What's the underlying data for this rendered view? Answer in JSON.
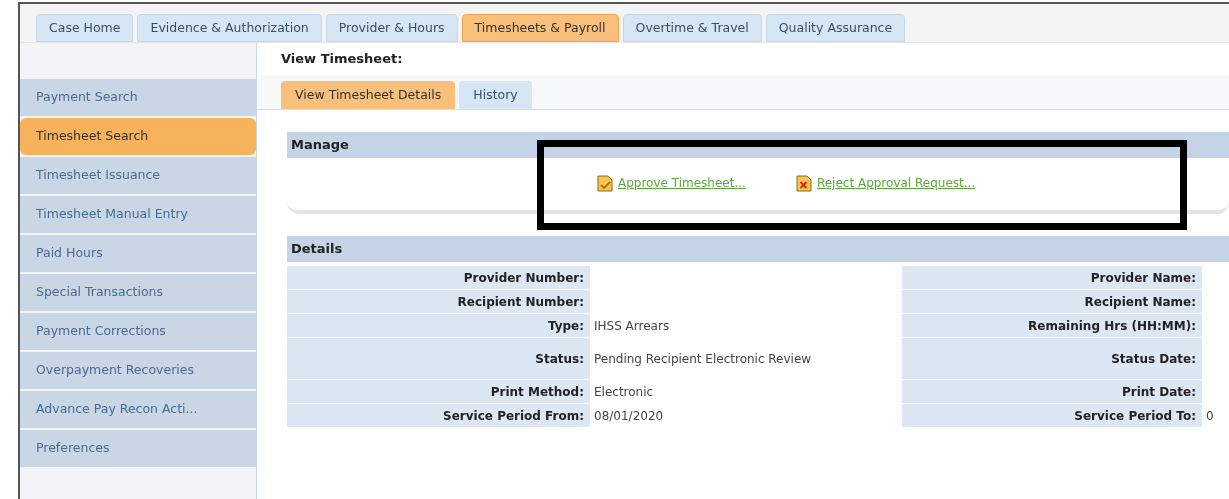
{
  "top_tabs": [
    {
      "label": "Case Home",
      "selected": false
    },
    {
      "label": "Evidence & Authorization",
      "selected": false
    },
    {
      "label": "Provider & Hours",
      "selected": false
    },
    {
      "label": "Timesheets & Payroll",
      "selected": true
    },
    {
      "label": "Overtime & Travel",
      "selected": false
    },
    {
      "label": "Quality Assurance",
      "selected": false
    }
  ],
  "sidebar": {
    "items": [
      {
        "label": "Payment Search",
        "selected": false
      },
      {
        "label": "Timesheet Search",
        "selected": true
      },
      {
        "label": "Timesheet Issuance",
        "selected": false
      },
      {
        "label": "Timesheet Manual Entry",
        "selected": false
      },
      {
        "label": "Paid Hours",
        "selected": false
      },
      {
        "label": "Special Transactions",
        "selected": false
      },
      {
        "label": "Payment Corrections",
        "selected": false
      },
      {
        "label": "Overpayment Recoveries",
        "selected": false
      },
      {
        "label": "Advance Pay Recon Acti...",
        "selected": false
      },
      {
        "label": "Preferences",
        "selected": false
      }
    ]
  },
  "page_title": "View Timesheet:",
  "sub_tabs": [
    {
      "label": "View Timesheet Details",
      "selected": true
    },
    {
      "label": "History",
      "selected": false
    }
  ],
  "manage": {
    "title": "Manage",
    "actions": [
      {
        "kind": "approve",
        "label": "Approve Timesheet..."
      },
      {
        "kind": "reject",
        "label": "Reject Approval Request..."
      }
    ],
    "highlighted": true
  },
  "details": {
    "title": "Details",
    "rows": [
      {
        "label": "Provider Number:",
        "value": "",
        "label_2": "Provider Name:",
        "value_2": ""
      },
      {
        "label": "Recipient Number:",
        "value": "",
        "label_2": "Recipient Name:",
        "value_2": ""
      },
      {
        "label": "Type:",
        "value": "IHSS Arrears",
        "label_2": "Remaining Hrs (HH:MM):",
        "value_2": ""
      },
      {
        "label": "Status:",
        "value": "Pending Recipient Electronic Review",
        "label_2": "Status Date:",
        "value_2": ""
      },
      {
        "label": "Print Method:",
        "value": "Electronic",
        "label_2": "Print Date:",
        "value_2": ""
      },
      {
        "label": "Service Period From:",
        "value": "08/01/2020",
        "label_2": "Service Period To:",
        "value_2": "0"
      }
    ]
  }
}
